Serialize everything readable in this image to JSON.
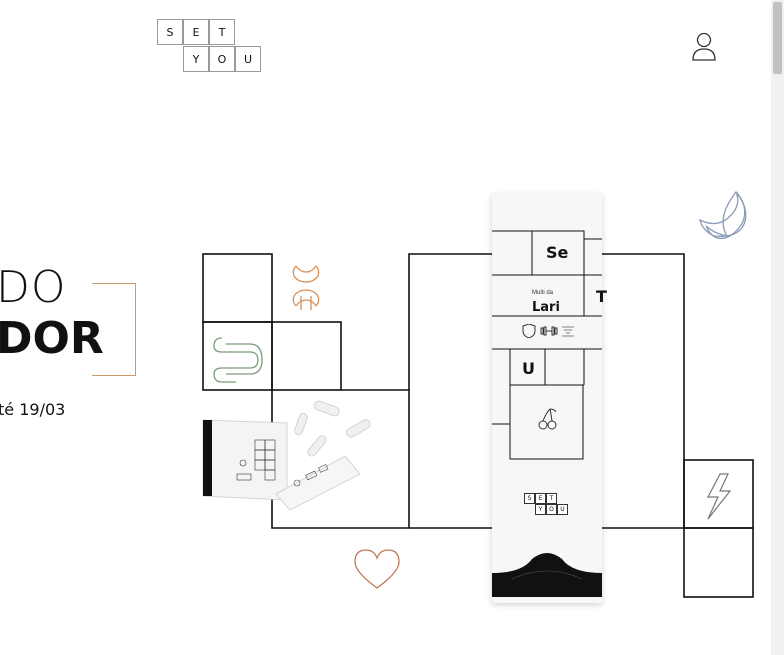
{
  "logo": {
    "row1": [
      "S",
      "E",
      "T"
    ],
    "row2": [
      "Y",
      "O",
      "U"
    ]
  },
  "header": {
    "account_icon": "user-icon"
  },
  "hero": {
    "line1": "DO",
    "line2": "DOR",
    "subtitle": "té 19/03"
  },
  "package": {
    "label_se": "Se",
    "label_t": "T",
    "label_u": "U",
    "multi_label": "Multi da",
    "name": "Lari",
    "mini_logo_row1": [
      "S",
      "E",
      "T"
    ],
    "mini_logo_row2": [
      "Y",
      "O",
      "U"
    ]
  },
  "icons": [
    "joint-icon",
    "intestine-icon",
    "moon-icon",
    "lightning-icon",
    "heart-icon",
    "cherry-icon",
    "shield-icon",
    "dumbbell-icon"
  ],
  "colors": {
    "accent_gold": "#c99a6c",
    "icon_green": "#7a9a7a",
    "icon_blue": "#8a9bb8",
    "line": "#111111"
  }
}
